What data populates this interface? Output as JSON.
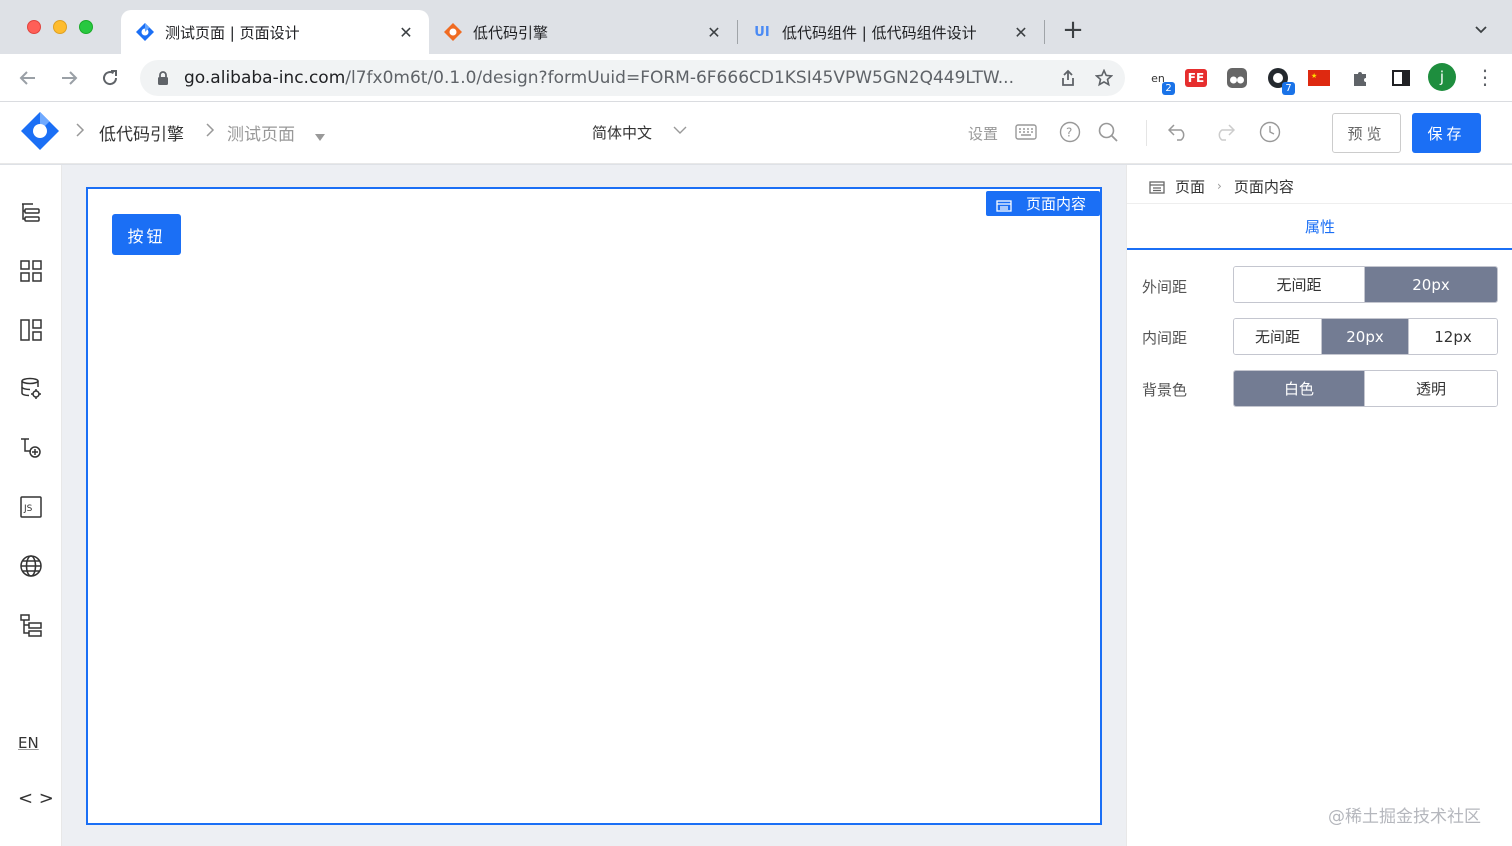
{
  "browser": {
    "tabs": [
      {
        "title": "测试页面 | 页面设计",
        "close": "✕"
      },
      {
        "title": "低代码引擎",
        "close": "✕"
      },
      {
        "title": "低代码组件 | 低代码组件设计",
        "close": "✕",
        "favicon_text": "UI"
      }
    ],
    "new_tab": "+",
    "url_host": "go.alibaba-inc.com",
    "url_path": "/l7fx0m6t/0.1.0/design?formUuid=FORM-6F666CD1KSI45VPW5GN2Q449LTW...",
    "extensions": [
      {
        "name": "translate-extension",
        "badge": "2"
      },
      {
        "name": "fe-extension",
        "label": "FE"
      },
      {
        "name": "tampermonkey-extension"
      },
      {
        "name": "github-extension",
        "badge": "7"
      },
      {
        "name": "china-flag-extension"
      }
    ],
    "avatar_letter": "j"
  },
  "header": {
    "breadcrumb_app": "低代码引擎",
    "breadcrumb_page": "测试页面",
    "language": "简体中文",
    "settings_label": "设置",
    "preview_label": "预览",
    "save_label": "保存"
  },
  "sidebar": {
    "icons": [
      "outline-tree-icon",
      "components-grid-icon",
      "layout-icon",
      "datasource-icon",
      "actions-icon",
      "js-icon",
      "i18n-globe-icon",
      "schema-tree-icon"
    ],
    "lang_label": "EN",
    "code_label": "< >"
  },
  "canvas": {
    "frame_tag": "页面内容",
    "button_label": "按钮"
  },
  "panel": {
    "breadcrumb_root": "页面",
    "breadcrumb_current": "页面内容",
    "tab_label": "属性",
    "props": [
      {
        "label": "外间距",
        "options": [
          "无间距",
          "20px"
        ],
        "selected": "20px"
      },
      {
        "label": "内间距",
        "options": [
          "无间距",
          "20px",
          "12px"
        ],
        "selected": "20px"
      },
      {
        "label": "背景色",
        "options": [
          "白色",
          "透明"
        ],
        "selected": "白色"
      }
    ]
  },
  "watermark": "@稀土掘金技术社区",
  "colors": {
    "accent": "#1b6ff5",
    "segment_selected": "#737c93",
    "canvas_bg": "#edeff3"
  }
}
